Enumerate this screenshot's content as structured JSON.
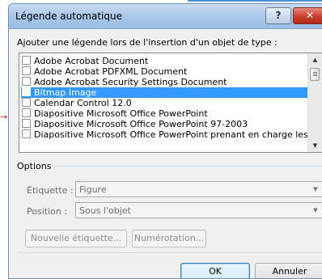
{
  "window": {
    "title": "Légende automatique",
    "help_label": "?",
    "close_label": "✕"
  },
  "list_section": {
    "label": "Ajouter une légende lors de l'insertion d'un objet de type :",
    "items": [
      {
        "label": "Adobe Acrobat Document",
        "checked": false,
        "selected": false
      },
      {
        "label": "Adobe Acrobat PDFXML Document",
        "checked": false,
        "selected": false
      },
      {
        "label": "Adobe Acrobat Security Settings Document",
        "checked": false,
        "selected": false
      },
      {
        "label": "Bitmap Image",
        "checked": false,
        "selected": true
      },
      {
        "label": "Calendar Control 12.0",
        "checked": false,
        "selected": false
      },
      {
        "label": "Diapositive Microsoft Office PowerPoint",
        "checked": false,
        "selected": false
      },
      {
        "label": "Diapositive Microsoft Office PowerPoint 97-2003",
        "checked": false,
        "selected": false
      },
      {
        "label": "Diapositive Microsoft Office PowerPoint prenant en charge les macros",
        "checked": false,
        "selected": false
      }
    ],
    "scroll_up_glyph": "▲",
    "scroll_down_glyph": "▼"
  },
  "options": {
    "heading": "Options",
    "etiquette_label": "Étiquette :",
    "etiquette_value": "Figure",
    "position_label": "Position :",
    "position_value": "Sous l'objet",
    "combo_arrow_glyph": "▼"
  },
  "buttons": {
    "new_label": "Nouvelle étiquette...",
    "numbering": "Numérotation...",
    "ok": "OK",
    "cancel": "Annuler"
  },
  "side_marker": "→"
}
